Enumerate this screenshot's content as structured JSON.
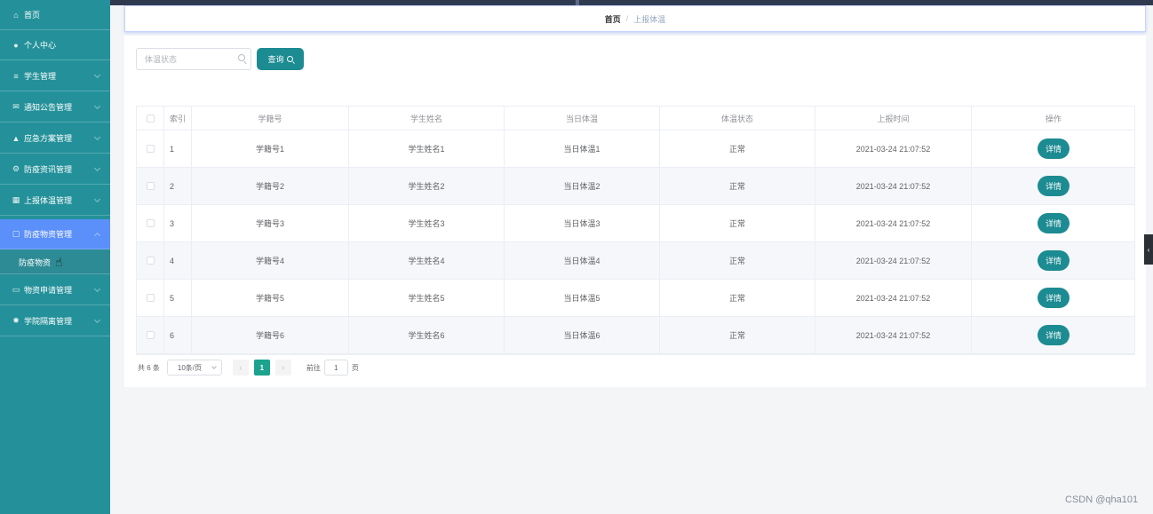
{
  "breadcrumb": {
    "home": "首页",
    "separator": "/",
    "current": "上报体温"
  },
  "sidebar": {
    "items": [
      {
        "label": "首页",
        "icon": "home-icon",
        "glyph": "⌂"
      },
      {
        "label": "个人中心",
        "icon": "user-icon",
        "glyph": "●"
      },
      {
        "label": "学生管理",
        "icon": "list-icon",
        "glyph": "≡"
      },
      {
        "label": "通知公告管理",
        "icon": "mail-icon",
        "glyph": "✉"
      },
      {
        "label": "应急方案管理",
        "icon": "person-icon",
        "glyph": "▲"
      },
      {
        "label": "防疫资讯管理",
        "icon": "gear-icon",
        "glyph": "⚙"
      },
      {
        "label": "上报体温管理",
        "icon": "chart-icon",
        "glyph": "▦"
      },
      {
        "label": "防疫物资管理",
        "icon": "doc-icon",
        "glyph": "▢"
      },
      {
        "label": "物资申请管理",
        "icon": "form-icon",
        "glyph": "▭"
      },
      {
        "label": "学院隔离管理",
        "icon": "cog-icon",
        "glyph": "✹"
      }
    ],
    "submenu": {
      "label": "防疫物资"
    }
  },
  "search": {
    "placeholder": "体温状态",
    "button_label": "查询"
  },
  "table": {
    "headers": [
      "索引",
      "学籍号",
      "学生姓名",
      "当日体温",
      "体温状态",
      "上报时间",
      "操作"
    ],
    "rows": [
      {
        "index": "1",
        "student_id": "学籍号1",
        "name": "学生姓名1",
        "temperature": "当日体温1",
        "status": "正常",
        "time": "2021-03-24 21:07:52",
        "action": "详情"
      },
      {
        "index": "2",
        "student_id": "学籍号2",
        "name": "学生姓名2",
        "temperature": "当日体温2",
        "status": "正常",
        "time": "2021-03-24 21:07:52",
        "action": "详情"
      },
      {
        "index": "3",
        "student_id": "学籍号3",
        "name": "学生姓名3",
        "temperature": "当日体温3",
        "status": "正常",
        "time": "2021-03-24 21:07:52",
        "action": "详情"
      },
      {
        "index": "4",
        "student_id": "学籍号4",
        "name": "学生姓名4",
        "temperature": "当日体温4",
        "status": "正常",
        "time": "2021-03-24 21:07:52",
        "action": "详情"
      },
      {
        "index": "5",
        "student_id": "学籍号5",
        "name": "学生姓名5",
        "temperature": "当日体温5",
        "status": "正常",
        "time": "2021-03-24 21:07:52",
        "action": "详情"
      },
      {
        "index": "6",
        "student_id": "学籍号6",
        "name": "学生姓名6",
        "temperature": "当日体温6",
        "status": "正常",
        "time": "2021-03-24 21:07:52",
        "action": "详情"
      }
    ]
  },
  "pagination": {
    "total": "共 6 条",
    "page_size": "10条/页",
    "prev": "‹",
    "current_page": "1",
    "next": "›",
    "goto_label": "前往",
    "goto_value": "1",
    "page_unit": "页"
  },
  "watermark": "CSDN @qha101",
  "colors": {
    "sidebar": "#24919a",
    "active_menu": "#5b8ff9",
    "primary_button": "#1c8b92",
    "page_active": "#1ca38d"
  }
}
